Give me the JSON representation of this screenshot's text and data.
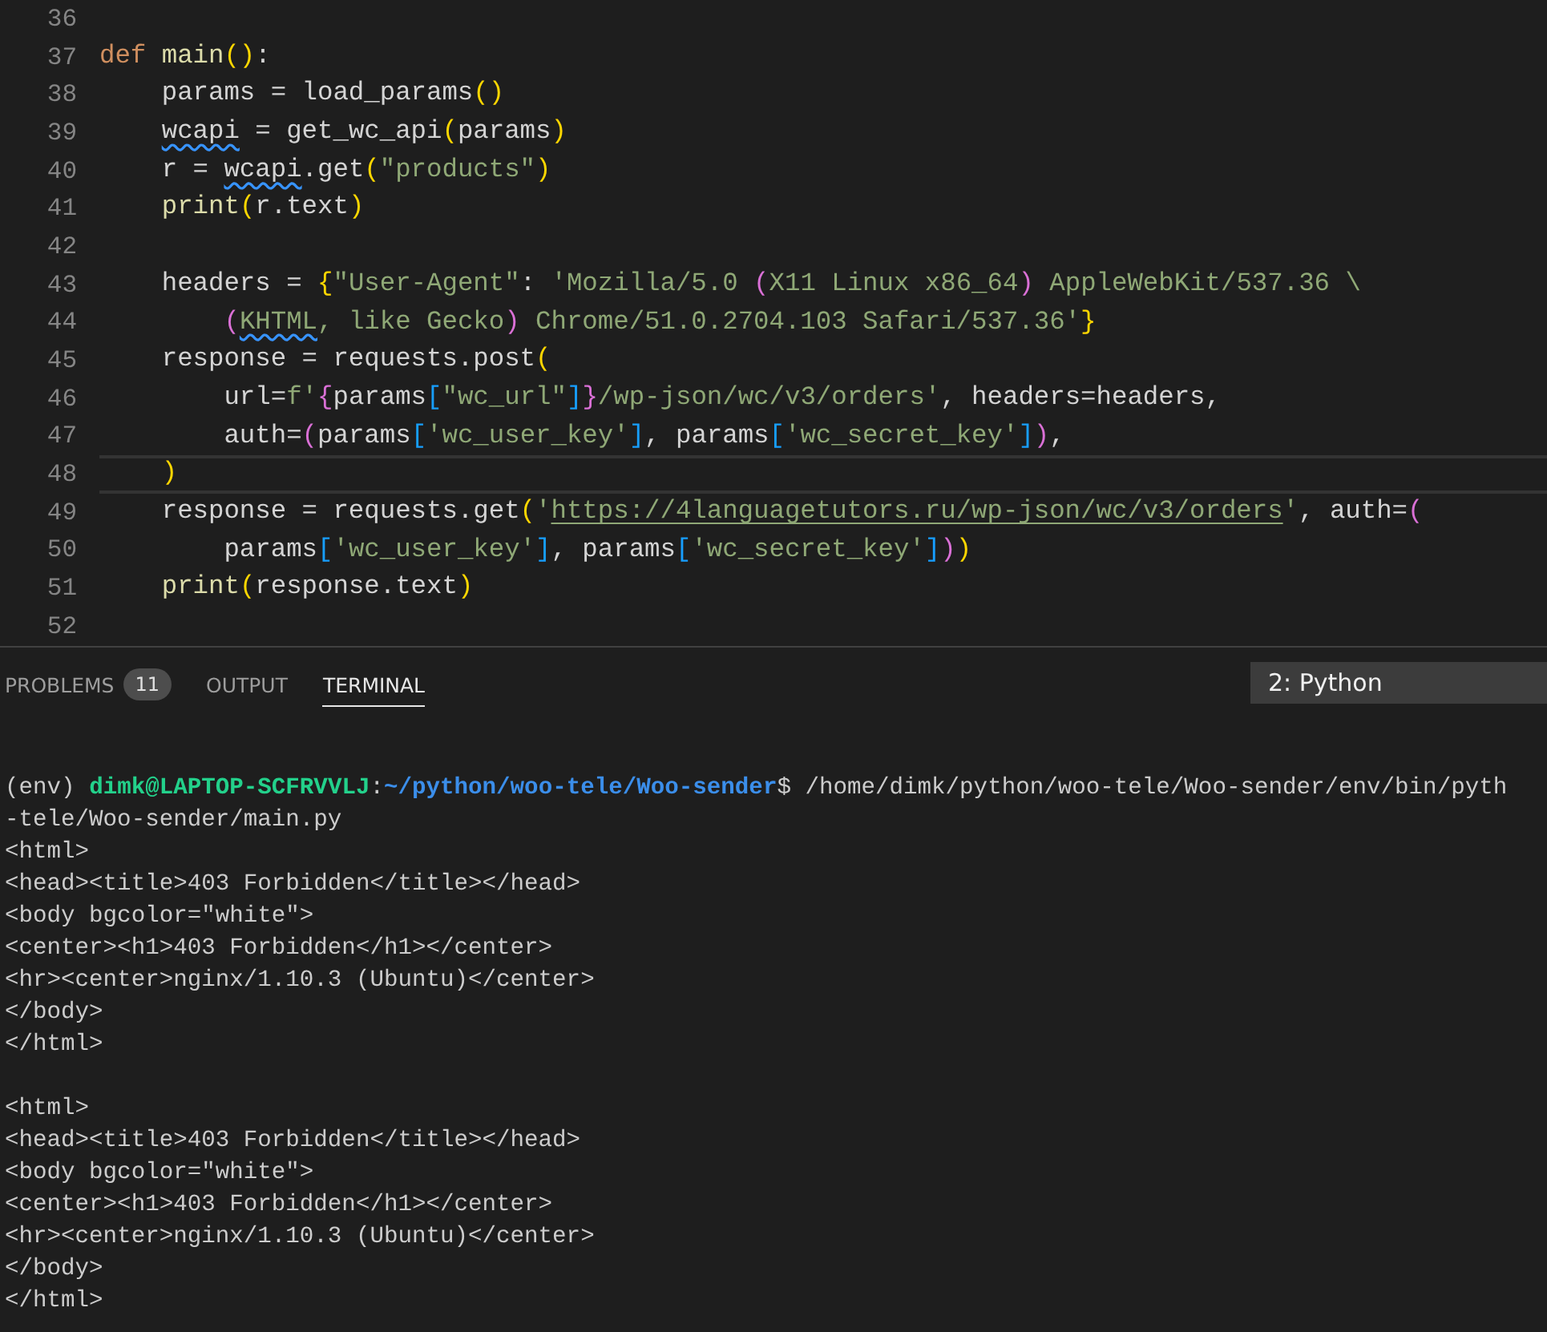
{
  "editor": {
    "lines": [
      {
        "number": "36"
      },
      {
        "number": "37",
        "current": false,
        "tokens": [
          {
            "text": "def ",
            "kind": "kw"
          },
          {
            "text": "main",
            "kind": "fn"
          },
          {
            "text": "()",
            "kind": "b1"
          },
          {
            "text": ":",
            "kind": "p"
          }
        ]
      },
      {
        "number": "38",
        "current": false,
        "tokens": [
          {
            "text": "    params = load_params",
            "kind": "p"
          },
          {
            "text": "()",
            "kind": "b1"
          }
        ]
      },
      {
        "number": "39",
        "current": false,
        "tokens": [
          {
            "text": "    wcapi",
            "kind": "warn"
          },
          {
            "text": " = get_wc_api",
            "kind": "p"
          },
          {
            "text": "(",
            "kind": "b1"
          },
          {
            "text": "params",
            "kind": "p"
          },
          {
            "text": ")",
            "kind": "b1"
          }
        ]
      },
      {
        "number": "40",
        "current": false,
        "tokens": [
          {
            "text": "    r = ",
            "kind": "p"
          },
          {
            "text": "wcapi",
            "kind": "warn"
          },
          {
            "text": ".get",
            "kind": "p"
          },
          {
            "text": "(",
            "kind": "b1"
          },
          {
            "text": "\"products\"",
            "kind": "str"
          },
          {
            "text": ")",
            "kind": "b1"
          }
        ]
      },
      {
        "number": "41",
        "current": false,
        "tokens": [
          {
            "text": "    print",
            "kind": "fn"
          },
          {
            "text": "(",
            "kind": "b1"
          },
          {
            "text": "r.text",
            "kind": "p"
          },
          {
            "text": ")",
            "kind": "b1"
          }
        ]
      },
      {
        "number": "42"
      },
      {
        "number": "43",
        "current": false,
        "tokens": [
          {
            "text": "    headers = ",
            "kind": "p"
          },
          {
            "text": "{",
            "kind": "b1"
          },
          {
            "text": "\"User-Agent\"",
            "kind": "str"
          },
          {
            "text": ": ",
            "kind": "p"
          },
          {
            "text": "'Mozilla/5.0 ",
            "kind": "str"
          },
          {
            "text": "(",
            "kind": "b2"
          },
          {
            "text": "X11 Linux x86_64",
            "kind": "str"
          },
          {
            "text": ")",
            "kind": "b2"
          },
          {
            "text": " AppleWebKit/537.36 \\",
            "kind": "str"
          }
        ]
      },
      {
        "number": "44",
        "current": false,
        "tokens": [
          {
            "text": "        (",
            "kind": "b2"
          },
          {
            "text": "KHTML",
            "kind": "strwarn"
          },
          {
            "text": ", like Gecko",
            "kind": "str"
          },
          {
            "text": ")",
            "kind": "b2"
          },
          {
            "text": " Chrome/51.0.2704.103 Safari/537.36'",
            "kind": "str"
          },
          {
            "text": "}",
            "kind": "b1"
          }
        ]
      },
      {
        "number": "45",
        "current": false,
        "tokens": [
          {
            "text": "    response = requests.post",
            "kind": "p"
          },
          {
            "text": "(",
            "kind": "b1"
          }
        ]
      },
      {
        "number": "46",
        "current": false,
        "tokens": [
          {
            "text": "        url=",
            "kind": "p"
          },
          {
            "text": "f'",
            "kind": "str"
          },
          {
            "text": "{",
            "kind": "b2"
          },
          {
            "text": "params",
            "kind": "p"
          },
          {
            "text": "[",
            "kind": "b3"
          },
          {
            "text": "\"wc_url\"",
            "kind": "str"
          },
          {
            "text": "]",
            "kind": "b3"
          },
          {
            "text": "}",
            "kind": "b2"
          },
          {
            "text": "/wp-json/wc/v3/orders'",
            "kind": "str"
          },
          {
            "text": ", headers=headers,",
            "kind": "p"
          }
        ]
      },
      {
        "number": "47",
        "current": false,
        "tokens": [
          {
            "text": "        auth=",
            "kind": "p"
          },
          {
            "text": "(",
            "kind": "b2"
          },
          {
            "text": "params",
            "kind": "p"
          },
          {
            "text": "[",
            "kind": "b3"
          },
          {
            "text": "'wc_user_key'",
            "kind": "str"
          },
          {
            "text": "]",
            "kind": "b3"
          },
          {
            "text": ", params",
            "kind": "p"
          },
          {
            "text": "[",
            "kind": "b3"
          },
          {
            "text": "'wc_secret_key'",
            "kind": "str"
          },
          {
            "text": "]",
            "kind": "b3"
          },
          {
            "text": ")",
            "kind": "b2"
          },
          {
            "text": ",",
            "kind": "p"
          }
        ]
      },
      {
        "number": "48",
        "current": true,
        "tokens": [
          {
            "text": "    )",
            "kind": "b1"
          }
        ]
      },
      {
        "number": "49",
        "current": false,
        "tokens": [
          {
            "text": "    response = requests.get",
            "kind": "p"
          },
          {
            "text": "(",
            "kind": "b1"
          },
          {
            "text": "'",
            "kind": "str"
          },
          {
            "text": "https://4languagetutors.ru/wp-json/wc/v3/orders",
            "kind": "link"
          },
          {
            "text": "'",
            "kind": "str"
          },
          {
            "text": ", auth=",
            "kind": "p"
          },
          {
            "text": "(",
            "kind": "b2"
          }
        ]
      },
      {
        "number": "50",
        "current": false,
        "tokens": [
          {
            "text": "        params",
            "kind": "p"
          },
          {
            "text": "[",
            "kind": "b3"
          },
          {
            "text": "'wc_user_key'",
            "kind": "str"
          },
          {
            "text": "]",
            "kind": "b3"
          },
          {
            "text": ", params",
            "kind": "p"
          },
          {
            "text": "[",
            "kind": "b3"
          },
          {
            "text": "'wc_secret_key'",
            "kind": "str"
          },
          {
            "text": "]",
            "kind": "b3"
          },
          {
            "text": ")",
            "kind": "b2"
          },
          {
            "text": ")",
            "kind": "b1"
          }
        ]
      },
      {
        "number": "51",
        "current": false,
        "tokens": [
          {
            "text": "    print",
            "kind": "fn"
          },
          {
            "text": "(",
            "kind": "b1"
          },
          {
            "text": "response.text",
            "kind": "p"
          },
          {
            "text": ")",
            "kind": "b1"
          }
        ]
      },
      {
        "number": "52"
      }
    ]
  },
  "panel": {
    "tabs": [
      {
        "label": "PROBLEMS",
        "badge": "11",
        "selected": false
      },
      {
        "label": "OUTPUT",
        "selected": false
      },
      {
        "label": "TERMINAL",
        "selected": true
      }
    ],
    "terminal_select": {
      "value": "2: Python"
    }
  },
  "terminal": {
    "prompt": {
      "env": "(env)",
      "user": "dimk@LAPTOP-SCFRVVLJ",
      "separator": ":",
      "path": "~/python/woo-tele/Woo-sender",
      "command": "$ /home/dimk/python/woo-tele/Woo-sender/env/bin/pyth"
    },
    "output_blocks": [
      [
        "-tele/Woo-sender/main.py",
        "<html>",
        "<head><title>403 Forbidden</title></head>",
        "<body bgcolor=\"white\">",
        "<center><h1>403 Forbidden</h1></center>",
        "<hr><center>nginx/1.10.3 (Ubuntu)</center>",
        "</body>",
        "</html>"
      ],
      [
        "<html>",
        "<head><title>403 Forbidden</title></head>",
        "<body bgcolor=\"white\">",
        "<center><h1>403 Forbidden</h1></center>",
        "<hr><center>nginx/1.10.3 (Ubuntu)</center>",
        "</body>",
        "</html>"
      ]
    ]
  }
}
